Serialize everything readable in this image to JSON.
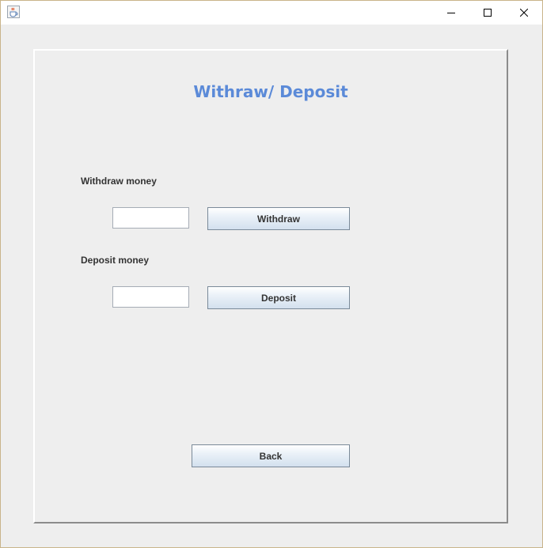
{
  "titlebar": {
    "icons": {
      "app": "java-cup-icon",
      "minimize": "minimize-icon",
      "maximize": "maximize-icon",
      "close": "close-icon"
    }
  },
  "panel": {
    "heading": "Withraw/ Deposit",
    "withdraw": {
      "label": "Withdraw money",
      "input_value": "",
      "button_label": "Withdraw"
    },
    "deposit": {
      "label": "Deposit money",
      "input_value": "",
      "button_label": "Deposit"
    },
    "back_button_label": "Back"
  },
  "colors": {
    "heading": "#5b8ad8",
    "panel_bg": "#eeeeee",
    "button_border": "#7a8a99"
  }
}
